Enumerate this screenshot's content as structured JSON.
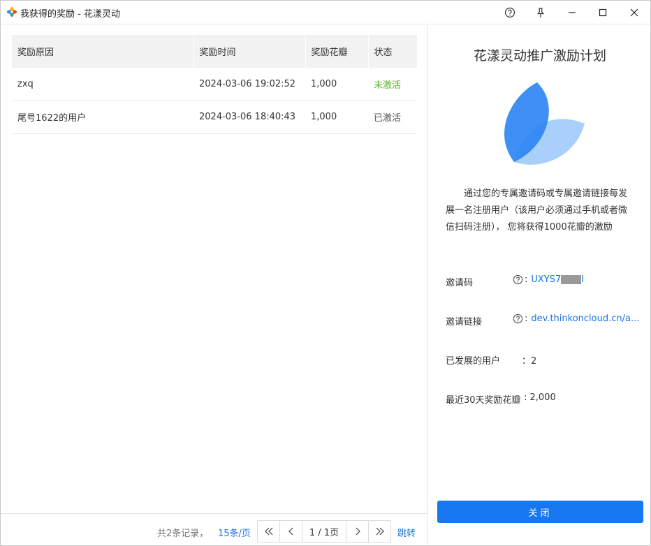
{
  "window": {
    "title": "我获得的奖励 - 花漾灵动",
    "icons": {
      "app": "flower-logo-icon",
      "help": "help-circle-icon",
      "pin": "pin-icon",
      "minimize": "minimize-icon",
      "maximize": "maximize-icon",
      "close": "close-icon"
    }
  },
  "table": {
    "columns": [
      "奖励原因",
      "奖励时间",
      "奖励花瓣",
      "状态"
    ],
    "rows": [
      {
        "reason": "zxq",
        "time": "2024-03-06 19:02:52",
        "petals": "1,000",
        "status": "未激活",
        "status_color": "#5bb42a"
      },
      {
        "reason": "尾号1622的用户",
        "time": "2024-03-06 18:40:43",
        "petals": "1,000",
        "status": "已激活",
        "status_color": "#555555"
      }
    ]
  },
  "pager": {
    "total": "共2条记录，",
    "page_size": "15条/页",
    "page": "1 / 1页",
    "jump": "跳转",
    "icons": {
      "first": "double-chevron-left-icon",
      "prev": "chevron-left-icon",
      "next": "chevron-right-icon",
      "last": "double-chevron-right-icon"
    }
  },
  "panel": {
    "title": "花漾灵动推广激励计划",
    "description": "通过您的专属邀请码或专属邀请链接每发展一名注册用户（该用户必须通过手机或者微信扫码注册）， 您将获得1000花瓣的激励",
    "invite_code_label": "邀请码",
    "invite_code_prefix": "UXYS7",
    "invite_code_suffix": "I",
    "invite_link_label": "邀请链接",
    "invite_link": "dev.thinkoncloud.cn/a...",
    "colon": ":",
    "users_label": "已发展的用户",
    "users_value": "：2",
    "reward_label": "最近30天奖励花瓣",
    "reward_value": ": 2,000",
    "close_button": "关闭",
    "accent_color": "#1677ee"
  }
}
